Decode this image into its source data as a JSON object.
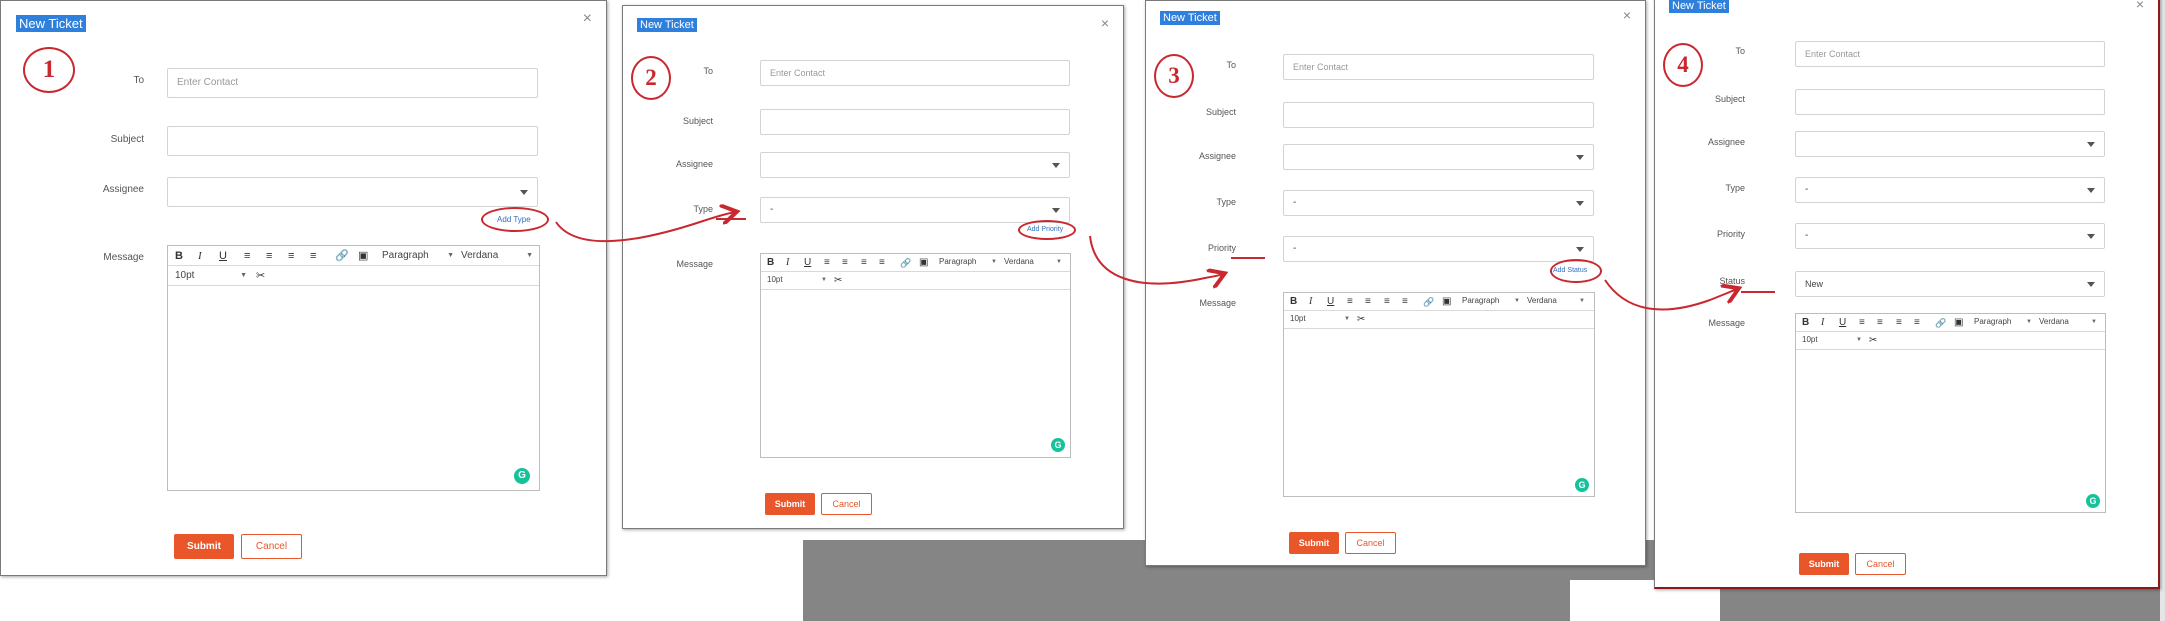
{
  "form": {
    "title": "New Ticket",
    "close_glyph": "×",
    "labels": {
      "to": "To",
      "subject": "Subject",
      "assignee": "Assignee",
      "type": "Type",
      "priority": "Priority",
      "status": "Status",
      "message": "Message"
    },
    "to_placeholder": "Enter Contact",
    "type_value": "-",
    "priority_value": "-",
    "status_value": "New",
    "add_type": "Add Type",
    "add_priority": "Add Priority",
    "add_status": "Add Status",
    "editor": {
      "bold": "B",
      "italic": "I",
      "underline": "U",
      "block_format": "Paragraph",
      "font_family": "Verdana",
      "font_size": "10pt",
      "grammarly": "G"
    },
    "submit_label": "Submit",
    "cancel_label": "Cancel"
  },
  "steps": [
    "1",
    "2",
    "3",
    "4"
  ],
  "colors": {
    "title_highlight": "#2f7fdc",
    "annotation_red": "#c8282e",
    "submit_orange": "#e8562a",
    "grammarly_green": "#15c39a"
  }
}
